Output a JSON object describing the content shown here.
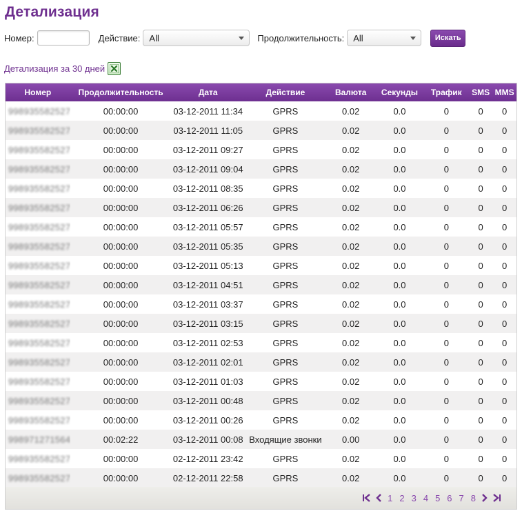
{
  "title": "Детализация",
  "filters": {
    "number_label": "Номер:",
    "number_value": "",
    "action_label": "Действие:",
    "action_value": "All",
    "duration_label": "Продолжительность:",
    "duration_value": "All",
    "search_label": "Искать"
  },
  "detail_link": "Детализация за 30 дней",
  "columns": [
    "Номер",
    "Продолжительность",
    "Дата",
    "Действие",
    "Валюта",
    "Секунды",
    "Трафик",
    "SMS",
    "MMS"
  ],
  "rows": [
    [
      "998935582527",
      "00:00:00",
      "03-12-2011 11:34",
      "GPRS",
      "0.02",
      "0.0",
      "0",
      "0",
      "0"
    ],
    [
      "998935582527",
      "00:00:00",
      "03-12-2011 11:05",
      "GPRS",
      "0.02",
      "0.0",
      "0",
      "0",
      "0"
    ],
    [
      "998935582527",
      "00:00:00",
      "03-12-2011 09:27",
      "GPRS",
      "0.02",
      "0.0",
      "0",
      "0",
      "0"
    ],
    [
      "998935582527",
      "00:00:00",
      "03-12-2011 09:04",
      "GPRS",
      "0.02",
      "0.0",
      "0",
      "0",
      "0"
    ],
    [
      "998935582527",
      "00:00:00",
      "03-12-2011 08:35",
      "GPRS",
      "0.02",
      "0.0",
      "0",
      "0",
      "0"
    ],
    [
      "998935582527",
      "00:00:00",
      "03-12-2011 06:26",
      "GPRS",
      "0.02",
      "0.0",
      "0",
      "0",
      "0"
    ],
    [
      "998935582527",
      "00:00:00",
      "03-12-2011 05:57",
      "GPRS",
      "0.02",
      "0.0",
      "0",
      "0",
      "0"
    ],
    [
      "998935582527",
      "00:00:00",
      "03-12-2011 05:35",
      "GPRS",
      "0.02",
      "0.0",
      "0",
      "0",
      "0"
    ],
    [
      "998935582527",
      "00:00:00",
      "03-12-2011 05:13",
      "GPRS",
      "0.02",
      "0.0",
      "0",
      "0",
      "0"
    ],
    [
      "998935582527",
      "00:00:00",
      "03-12-2011 04:51",
      "GPRS",
      "0.02",
      "0.0",
      "0",
      "0",
      "0"
    ],
    [
      "998935582527",
      "00:00:00",
      "03-12-2011 03:37",
      "GPRS",
      "0.02",
      "0.0",
      "0",
      "0",
      "0"
    ],
    [
      "998935582527",
      "00:00:00",
      "03-12-2011 03:15",
      "GPRS",
      "0.02",
      "0.0",
      "0",
      "0",
      "0"
    ],
    [
      "998935582527",
      "00:00:00",
      "03-12-2011 02:53",
      "GPRS",
      "0.02",
      "0.0",
      "0",
      "0",
      "0"
    ],
    [
      "998935582527",
      "00:00:00",
      "03-12-2011 02:01",
      "GPRS",
      "0.02",
      "0.0",
      "0",
      "0",
      "0"
    ],
    [
      "998935582527",
      "00:00:00",
      "03-12-2011 01:03",
      "GPRS",
      "0.02",
      "0.0",
      "0",
      "0",
      "0"
    ],
    [
      "998935582527",
      "00:00:00",
      "03-12-2011 00:48",
      "GPRS",
      "0.02",
      "0.0",
      "0",
      "0",
      "0"
    ],
    [
      "998935582527",
      "00:00:00",
      "03-12-2011 00:26",
      "GPRS",
      "0.02",
      "0.0",
      "0",
      "0",
      "0"
    ],
    [
      "998971271564",
      "00:02:22",
      "03-12-2011 00:08",
      "Входящие звонки",
      "0.00",
      "0.0",
      "0",
      "0",
      "0"
    ],
    [
      "998935582527",
      "00:00:00",
      "02-12-2011 23:42",
      "GPRS",
      "0.02",
      "0.0",
      "0",
      "0",
      "0"
    ],
    [
      "998935582527",
      "00:00:00",
      "02-12-2011 22:58",
      "GPRS",
      "0.02",
      "0.0",
      "0",
      "0",
      "0"
    ]
  ],
  "pagination": {
    "pages": [
      "1",
      "2",
      "3",
      "4",
      "5",
      "6",
      "7",
      "8"
    ],
    "current": "1",
    "first_icon": "first-page-icon",
    "prev_icon": "prev-page-icon",
    "next_icon": "next-page-icon",
    "last_icon": "last-page-icon"
  },
  "colors": {
    "accent": "#6e2f8f",
    "header_top": "#8a4aae",
    "row_alt": "#f1f0f0"
  }
}
